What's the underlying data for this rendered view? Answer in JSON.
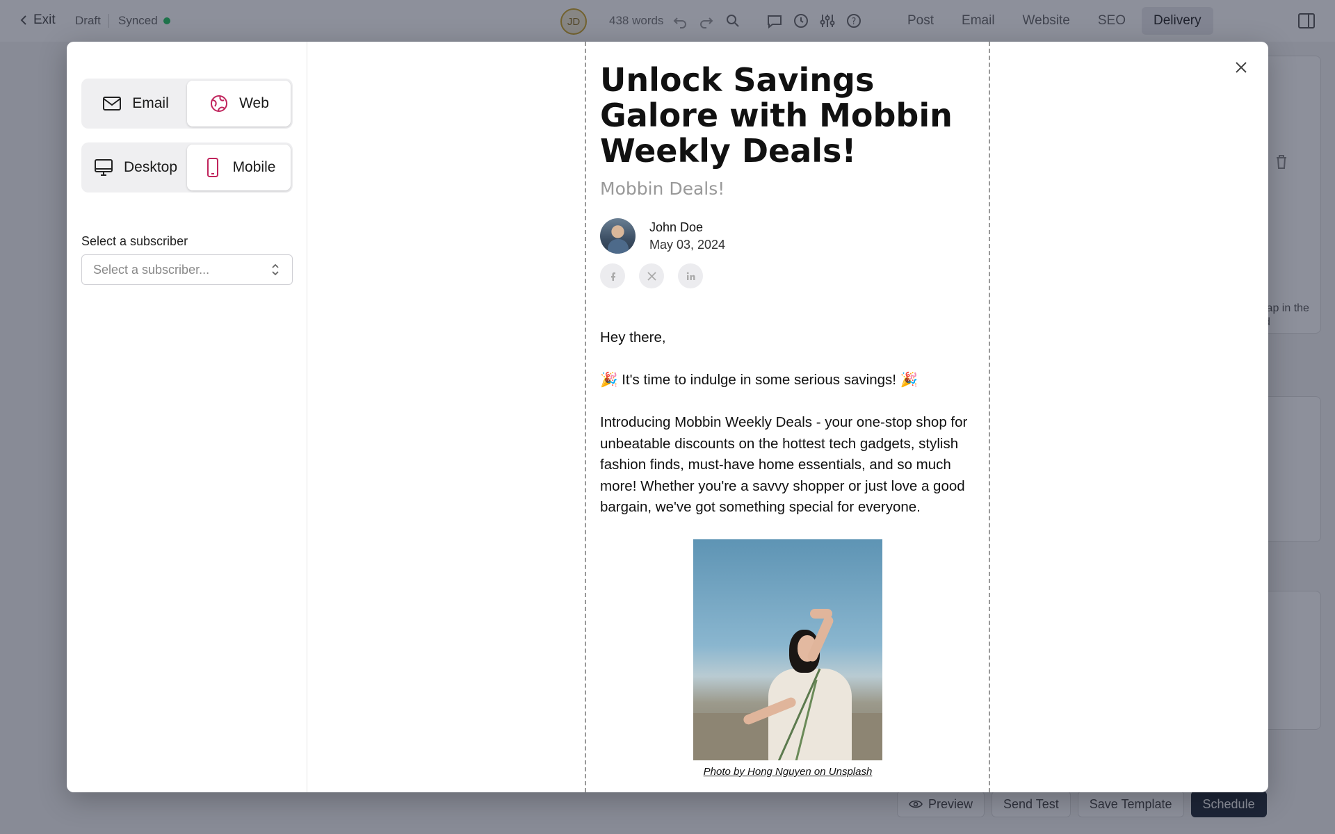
{
  "editor": {
    "topbar": {
      "exit_label": "Exit",
      "status": "Draft",
      "sync_status": "Synced",
      "user_initials": "JD",
      "word_count": "438 words",
      "tabs": [
        {
          "label": "Post"
        },
        {
          "label": "Email"
        },
        {
          "label": "Website"
        },
        {
          "label": "SEO"
        },
        {
          "label": "Delivery",
          "active": true
        }
      ]
    },
    "side_hint": "lap in the\nd",
    "bottom": {
      "preview": "Preview",
      "send_test": "Send Test",
      "save_template": "Save Template",
      "schedule": "Schedule"
    }
  },
  "modal": {
    "channel_toggle": [
      {
        "label": "Email",
        "icon": "mail-icon",
        "active": false
      },
      {
        "label": "Web",
        "icon": "globe-icon",
        "active": true
      }
    ],
    "device_toggle": [
      {
        "label": "Desktop",
        "icon": "desktop-icon",
        "active": false
      },
      {
        "label": "Mobile",
        "icon": "mobile-icon",
        "active": true
      }
    ],
    "subscriber_label": "Select a subscriber",
    "subscriber_placeholder": "Select a subscriber...",
    "accent_color": "#c0245c"
  },
  "email": {
    "title": "Unlock Savings Galore with Mobbin Weekly Deals!",
    "subtitle": "Mobbin Deals!",
    "author": {
      "name": "John Doe",
      "date": "May 03, 2024"
    },
    "social": [
      "facebook-icon",
      "x-icon",
      "linkedin-icon"
    ],
    "greeting": "Hey there,",
    "line1": "🎉 It's time to indulge in some serious savings! 🎉",
    "paragraph": "Introducing Mobbin Weekly Deals - your one-stop shop for unbeatable discounts on the hottest tech gadgets, stylish fashion finds, must-have home essentials, and so much more! Whether you're a savvy shopper or just love a good bargain, we've got something special for everyone.",
    "photo_caption": "Photo by Hong Nguyen on Unsplash"
  }
}
